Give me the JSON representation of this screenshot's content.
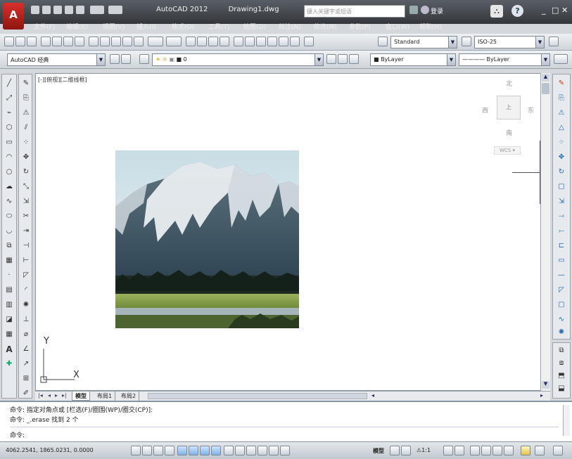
{
  "window": {
    "app_name": "AutoCAD 2012",
    "document": "Drawing1.dwg",
    "search_placeholder": "键入关键字或短语",
    "signin_label": "登录",
    "help_label": "?"
  },
  "menus": [
    "文件(F)",
    "编辑(E)",
    "视图(V)",
    "插入(I)",
    "格式(O)",
    "工具(T)",
    "绘图(D)",
    "标注(N)",
    "修改(M)",
    "参数(P)",
    "窗口(W)",
    "帮助(H)"
  ],
  "toolbar": {
    "text_style": "Standard",
    "dim_style": "ISO-25",
    "workspace": "AutoCAD 经典",
    "layer": "0",
    "color": "ByLayer",
    "linetype": "ByLayer"
  },
  "viewport": {
    "label": "[-][俯视][二维线框]"
  },
  "viewcube": {
    "north": "北",
    "south": "南",
    "west": "西",
    "east": "东",
    "top": "上",
    "wcs": "WCS"
  },
  "ucs": {
    "x": "X",
    "y": "Y"
  },
  "tabs": [
    "模型",
    "布局1",
    "布局2"
  ],
  "command": {
    "line1": "命令: 指定对角点或 [栏选(F)/圈围(WP)/圈交(CP)]:",
    "line2": "命令: _.erase 找到 2 个",
    "prompt": "命令:"
  },
  "status": {
    "coords": "4062.2541, 1865.0231, 0.0000",
    "model_label": "模型",
    "scale": "1:1"
  },
  "colors": {
    "title_bg": "#3b3f45",
    "accent": "#c8281e",
    "canvas": "#ffffff"
  }
}
